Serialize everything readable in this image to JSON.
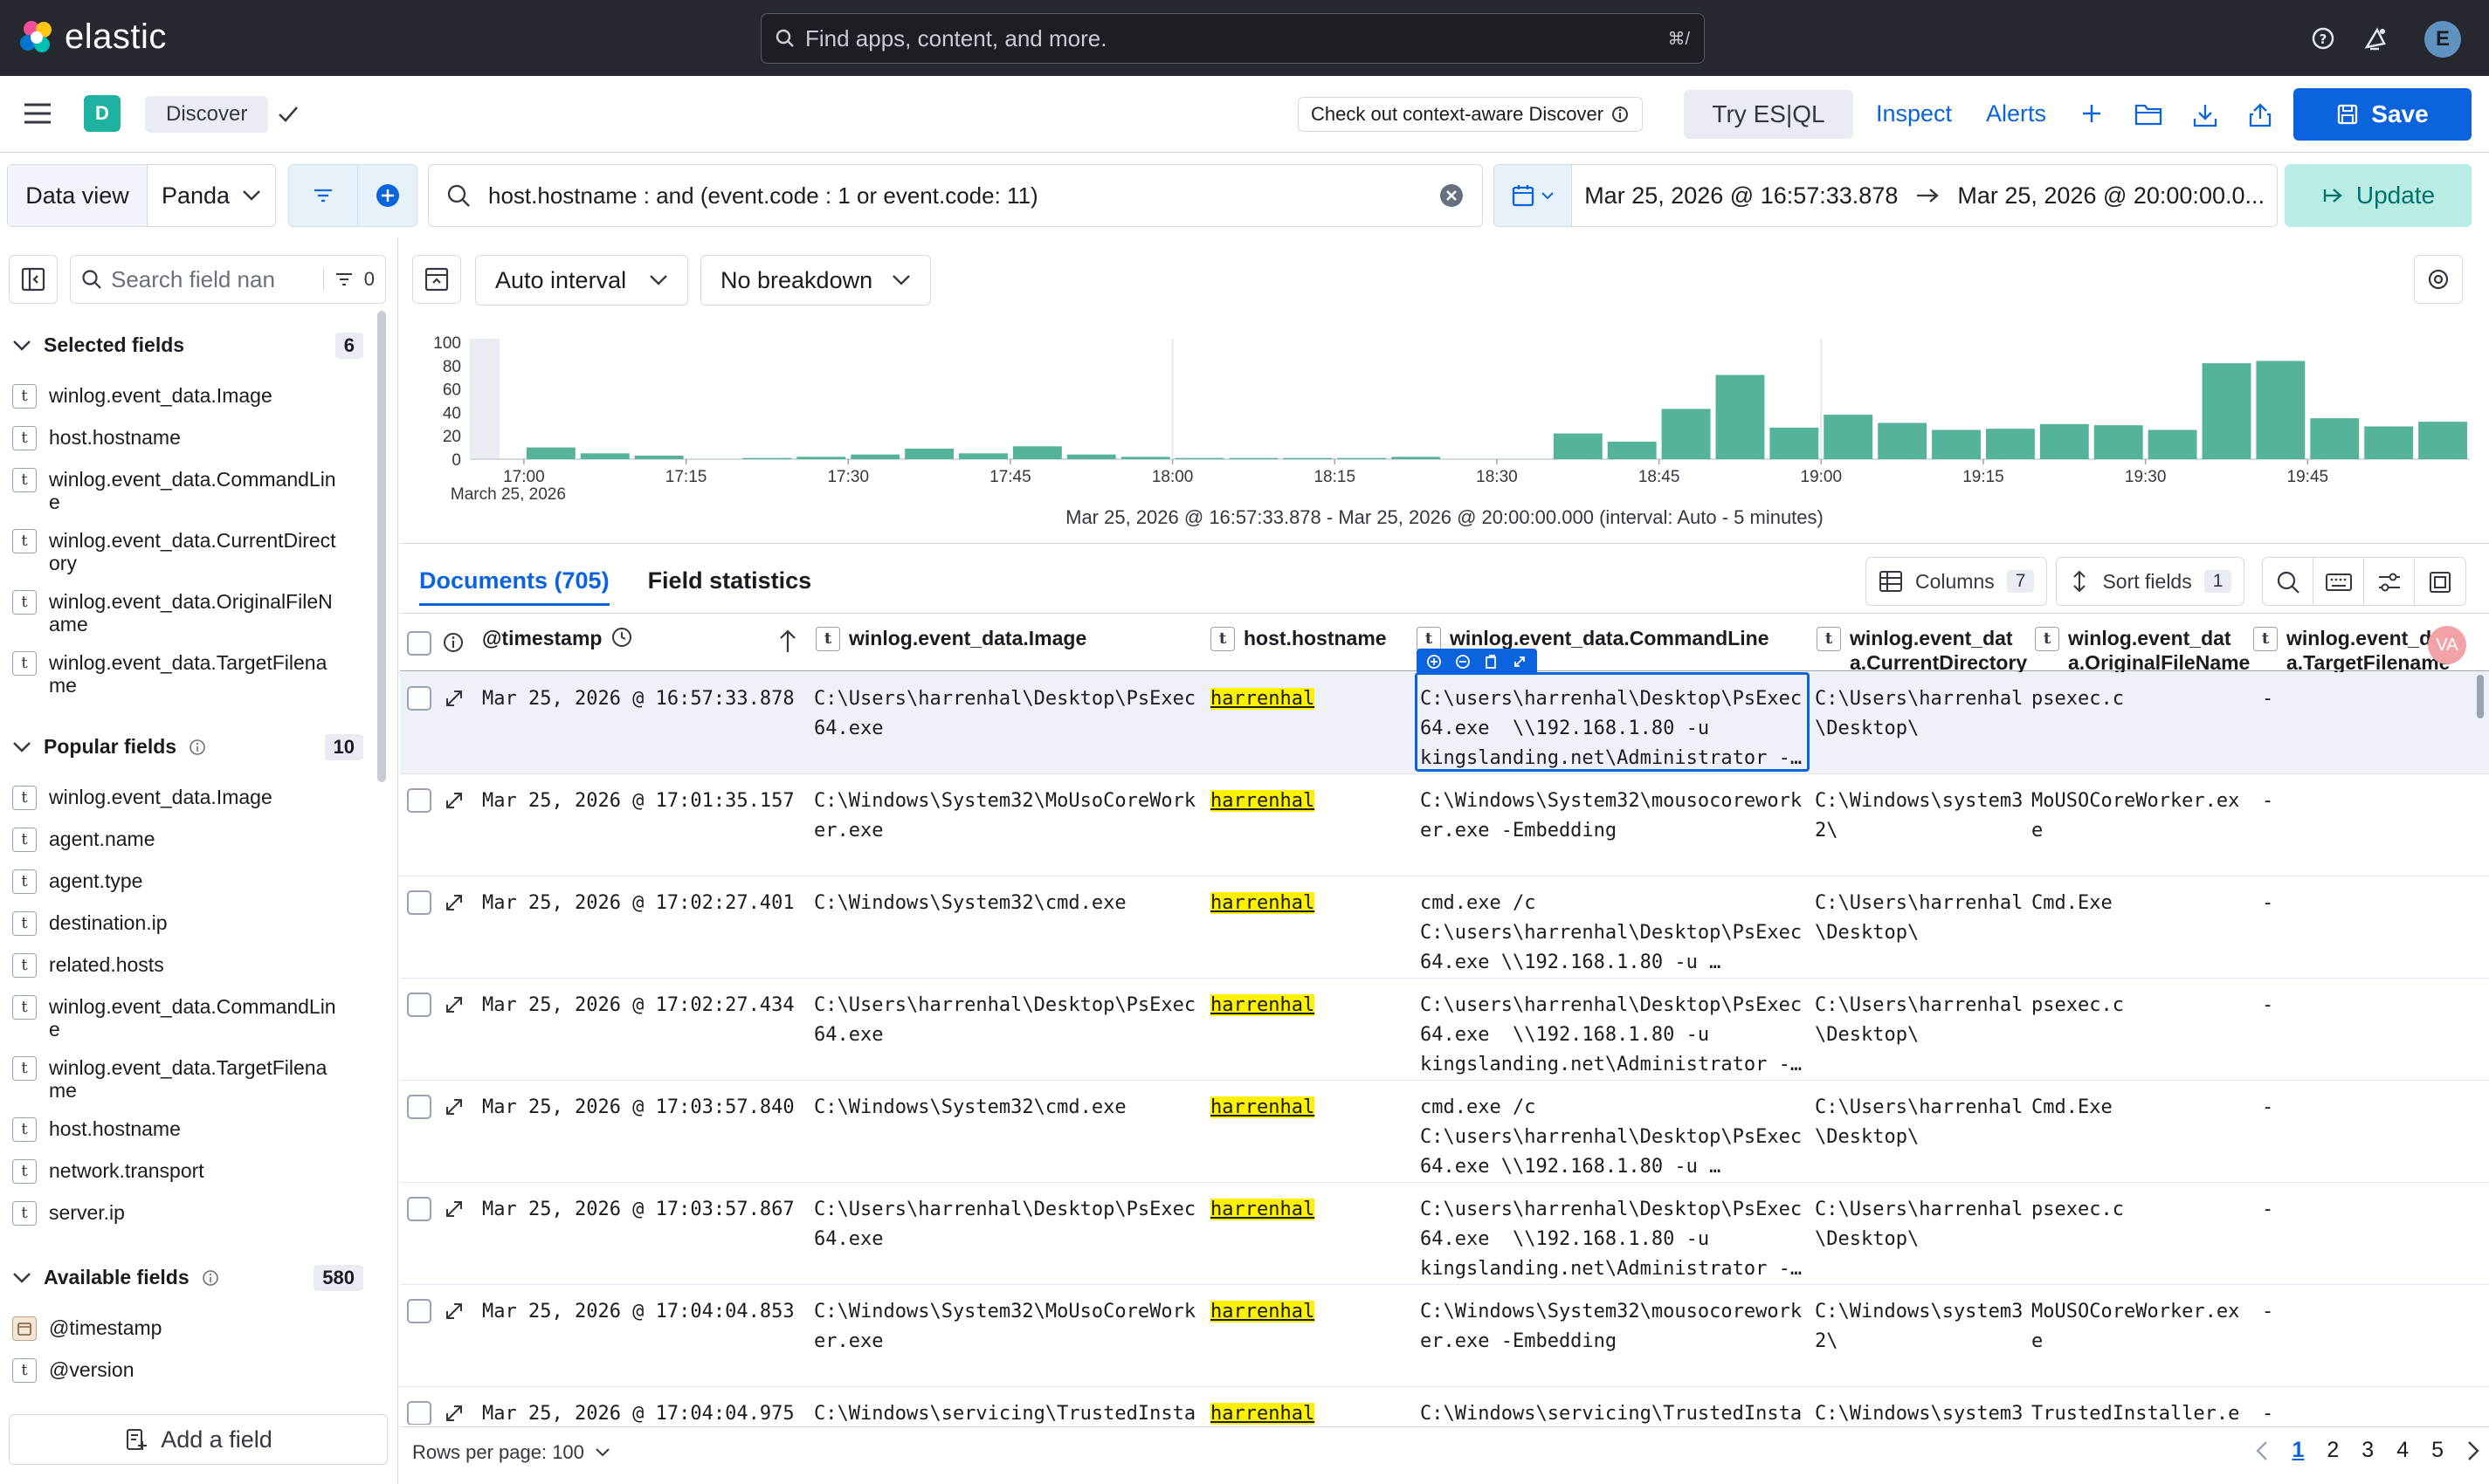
{
  "app": {
    "logo_text": "elastic",
    "global_search_placeholder": "Find apps, content, and more.",
    "global_search_shortcut": "⌘/",
    "avatar_initial": "E"
  },
  "header": {
    "space_initial": "D",
    "breadcrumb": "Discover",
    "context_aware": "Check out context-aware Discover",
    "try_esql": "Try ES|QL",
    "inspect": "Inspect",
    "alerts": "Alerts",
    "save": "Save"
  },
  "querybar": {
    "dataview_label": "Data view",
    "dataview_value": "Panda",
    "query": "host.hostname  : and (event.code : 1 or event.code: 11)",
    "date_from": "Mar 25, 2026 @ 16:57:33.878",
    "date_to": "Mar 25, 2026 @ 20:00:00.0...",
    "update": "Update"
  },
  "sidebar": {
    "search_placeholder": "Search field nan",
    "filter_count": "0",
    "selected": {
      "label": "Selected fields",
      "count": "6",
      "items": [
        {
          "type": "t",
          "name": "winlog.event_data.Image"
        },
        {
          "type": "t",
          "name": "host.hostname"
        },
        {
          "type": "t",
          "name": "winlog.event_data.CommandLine"
        },
        {
          "type": "t",
          "name": "winlog.event_data.CurrentDirectory"
        },
        {
          "type": "t",
          "name": "winlog.event_data.OriginalFileName"
        },
        {
          "type": "t",
          "name": "winlog.event_data.TargetFilename"
        }
      ]
    },
    "popular": {
      "label": "Popular fields",
      "count": "10",
      "items": [
        {
          "type": "t",
          "name": "winlog.event_data.Image"
        },
        {
          "type": "t",
          "name": "agent.name"
        },
        {
          "type": "t",
          "name": "agent.type"
        },
        {
          "type": "t",
          "name": "destination.ip"
        },
        {
          "type": "t",
          "name": "related.hosts"
        },
        {
          "type": "t",
          "name": "winlog.event_data.CommandLine"
        },
        {
          "type": "t",
          "name": "winlog.event_data.TargetFilename"
        },
        {
          "type": "t",
          "name": "host.hostname"
        },
        {
          "type": "t",
          "name": "network.transport"
        },
        {
          "type": "t",
          "name": "server.ip"
        }
      ]
    },
    "available": {
      "label": "Available fields",
      "count": "580",
      "items": [
        {
          "type": "date",
          "name": "@timestamp"
        },
        {
          "type": "t",
          "name": "@version"
        }
      ]
    },
    "add_field": "Add a field"
  },
  "toolbar": {
    "interval": "Auto interval",
    "breakdown": "No breakdown"
  },
  "chart_data": {
    "type": "bar",
    "ylim": [
      0,
      100
    ],
    "yticks": [
      0,
      20,
      40,
      60,
      80,
      100
    ],
    "x_start": "16:55",
    "x_interval_minutes": 5,
    "xticks": [
      "17:00",
      "17:15",
      "17:30",
      "17:45",
      "18:00",
      "18:15",
      "18:30",
      "18:45",
      "19:00",
      "19:15",
      "19:30",
      "19:45"
    ],
    "x_sublabel": "March 25, 2026",
    "values": [
      0,
      10,
      5,
      3,
      0,
      1,
      2,
      4,
      9,
      5,
      11,
      4,
      2,
      1,
      1,
      1,
      1,
      2,
      0,
      0,
      22,
      15,
      43,
      72,
      27,
      38,
      31,
      25,
      26,
      30,
      29,
      25,
      82,
      84,
      35,
      28,
      32
    ],
    "caption": "Mar 25, 2026 @ 16:57:33.878 - Mar 25, 2026 @ 20:00:00.000 (interval: Auto - 5 minutes)"
  },
  "tabs": {
    "documents": "Documents (705)",
    "field_stats": "Field statistics"
  },
  "grid_toolbar": {
    "columns": "Columns",
    "columns_count": "7",
    "sort": "Sort fields",
    "sort_count": "1"
  },
  "table": {
    "columns": [
      {
        "label": "@timestamp"
      },
      {
        "label": "winlog.event_data.Image"
      },
      {
        "label": "host.hostname"
      },
      {
        "label": "winlog.event_data.CommandLine"
      },
      {
        "label": "winlog.event_dat\na.CurrentDirectory"
      },
      {
        "label": "winlog.event_dat\na.OriginalFileName"
      },
      {
        "label": "winlog.event_dat\na.TargetFilename"
      }
    ],
    "rows": [
      {
        "ts": "Mar 25, 2026 @ 16:57:33.878",
        "image": "C:\\Users\\harrenhal\\Desktop\\PsExec\n64.exe",
        "host": "harrenhal",
        "cmd": "C:\\users\\harrenhal\\Desktop\\PsExec\n64.exe  \\\\192.168.1.80 -u\nkingslanding.net\\Administrator -…",
        "cwd": "C:\\Users\\harrenhal\n\\Desktop\\",
        "orig": "psexec.c",
        "target": "-"
      },
      {
        "ts": "Mar 25, 2026 @ 17:01:35.157",
        "image": "C:\\Windows\\System32\\MoUsoCoreWork\ner.exe",
        "host": "harrenhal",
        "cmd": "C:\\Windows\\System32\\mousocorework\ner.exe -Embedding",
        "cwd": "C:\\Windows\\system3\n2\\",
        "orig": "MoUSOCoreWorker.ex\ne",
        "target": "-"
      },
      {
        "ts": "Mar 25, 2026 @ 17:02:27.401",
        "image": "C:\\Windows\\System32\\cmd.exe",
        "host": "harrenhal",
        "cmd": "cmd.exe /c\nC:\\users\\harrenhal\\Desktop\\PsExec\n64.exe \\\\192.168.1.80 -u …",
        "cwd": "C:\\Users\\harrenhal\n\\Desktop\\",
        "orig": "Cmd.Exe",
        "target": "-"
      },
      {
        "ts": "Mar 25, 2026 @ 17:02:27.434",
        "image": "C:\\Users\\harrenhal\\Desktop\\PsExec\n64.exe",
        "host": "harrenhal",
        "cmd": "C:\\users\\harrenhal\\Desktop\\PsExec\n64.exe  \\\\192.168.1.80 -u\nkingslanding.net\\Administrator -…",
        "cwd": "C:\\Users\\harrenhal\n\\Desktop\\",
        "orig": "psexec.c",
        "target": "-"
      },
      {
        "ts": "Mar 25, 2026 @ 17:03:57.840",
        "image": "C:\\Windows\\System32\\cmd.exe",
        "host": "harrenhal",
        "cmd": "cmd.exe /c\nC:\\users\\harrenhal\\Desktop\\PsExec\n64.exe \\\\192.168.1.80 -u …",
        "cwd": "C:\\Users\\harrenhal\n\\Desktop\\",
        "orig": "Cmd.Exe",
        "target": "-"
      },
      {
        "ts": "Mar 25, 2026 @ 17:03:57.867",
        "image": "C:\\Users\\harrenhal\\Desktop\\PsExec\n64.exe",
        "host": "harrenhal",
        "cmd": "C:\\users\\harrenhal\\Desktop\\PsExec\n64.exe  \\\\192.168.1.80 -u\nkingslanding.net\\Administrator -…",
        "cwd": "C:\\Users\\harrenhal\n\\Desktop\\",
        "orig": "psexec.c",
        "target": "-"
      },
      {
        "ts": "Mar 25, 2026 @ 17:04:04.853",
        "image": "C:\\Windows\\System32\\MoUsoCoreWork\ner.exe",
        "host": "harrenhal",
        "cmd": "C:\\Windows\\System32\\mousocorework\ner.exe -Embedding",
        "cwd": "C:\\Windows\\system3\n2\\",
        "orig": "MoUSOCoreWorker.ex\ne",
        "target": "-"
      },
      {
        "ts": "Mar 25, 2026 @ 17:04:04.975",
        "image": "C:\\Windows\\servicing\\TrustedInsta",
        "host": "harrenhal",
        "cmd": "C:\\Windows\\servicing\\TrustedInsta",
        "cwd": "C:\\Windows\\system3",
        "orig": "TrustedInstaller.e",
        "target": "-"
      }
    ],
    "header_avatar": "VA"
  },
  "footer": {
    "rows_per_page": "Rows per page: 100",
    "pages": [
      "1",
      "2",
      "3",
      "4",
      "5"
    ]
  }
}
